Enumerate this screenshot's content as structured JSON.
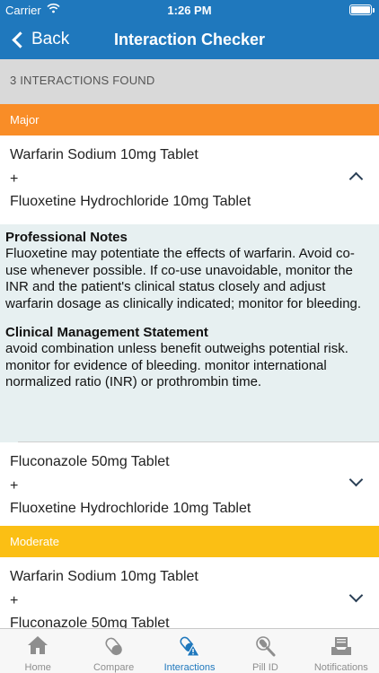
{
  "status_bar": {
    "carrier": "Carrier",
    "time": "1:26 PM"
  },
  "nav": {
    "back_label": "Back",
    "title": "Interaction Checker"
  },
  "results_header": "3 INTERACTIONS FOUND",
  "groups": [
    {
      "severity": "Major",
      "color": "#f98d27",
      "interactions": [
        {
          "drug1": "Warfarin Sodium 10mg Tablet",
          "plus": "+",
          "drug2": "Fluoxetine Hydrochloride 10mg Tablet",
          "expanded": true,
          "professional_notes_title": "Professional Notes",
          "professional_notes": "Fluoxetine may potentiate the effects of warfarin. Avoid co-use whenever possible. If co-use unavoidable, monitor the INR and the patient's clinical status closely and adjust warfarin dosage as clinically indicated; monitor for bleeding.",
          "clinical_management_title": "Clinical Management Statement",
          "clinical_management": "avoid combination unless benefit outweighs potential risk. monitor for evidence of bleeding. monitor international normalized ratio (INR) or prothrombin time."
        },
        {
          "drug1": "Fluconazole 50mg Tablet",
          "plus": "+",
          "drug2": "Fluoxetine Hydrochloride 10mg Tablet",
          "expanded": false
        }
      ]
    },
    {
      "severity": "Moderate",
      "color": "#fbbf14",
      "interactions": [
        {
          "drug1": "Warfarin Sodium 10mg Tablet",
          "plus": "+",
          "drug2": "Fluconazole 50mg Tablet",
          "expanded": false
        }
      ]
    }
  ],
  "tab_bar": {
    "active": "Interactions",
    "active_color": "#1f78bd",
    "tabs": [
      {
        "label": "Home",
        "icon": "home-icon"
      },
      {
        "label": "Compare",
        "icon": "pills-icon"
      },
      {
        "label": "Interactions",
        "icon": "interaction-warning-icon"
      },
      {
        "label": "Pill ID",
        "icon": "pill-search-icon"
      },
      {
        "label": "Notifications",
        "icon": "notification-tray-icon"
      }
    ]
  }
}
